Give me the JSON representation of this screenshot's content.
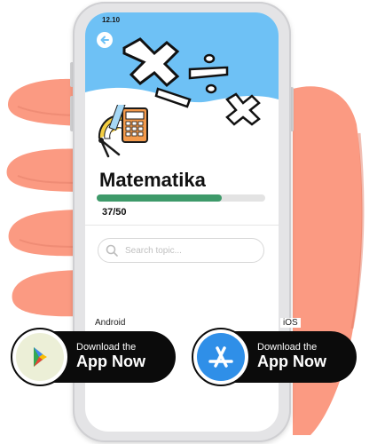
{
  "status": {
    "time": "12.10"
  },
  "subject": {
    "title": "Matematika"
  },
  "progress": {
    "text": "37/50",
    "fraction": 0.74
  },
  "search": {
    "placeholder": "Search topic..."
  },
  "stores": [
    {
      "platform": "Android",
      "line1": "Download the",
      "line2": "App Now"
    },
    {
      "platform": "iOS",
      "line1": "Download the",
      "line2": "App Now"
    }
  ],
  "colors": {
    "hero_blue": "#6ec1f5",
    "progress_green": "#3e9a6a",
    "hand": "#fb9a82",
    "pill": "#0b0b0b",
    "app_store_blue": "#2f8fe8"
  },
  "icons": {
    "back": "arrow-left-icon",
    "math": "calculator-compass-protractor-icon",
    "search": "search-icon",
    "android": "google-play-icon",
    "ios": "app-store-icon"
  }
}
